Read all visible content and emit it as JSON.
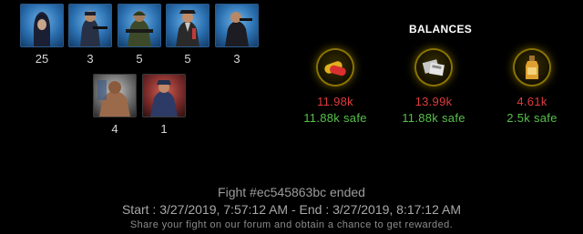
{
  "units": [
    {
      "name": "hooded-agent",
      "count": "25",
      "theme": "blue"
    },
    {
      "name": "mercenary",
      "count": "3",
      "theme": "blue"
    },
    {
      "name": "soldier",
      "count": "5",
      "theme": "blue"
    },
    {
      "name": "gangster",
      "count": "5",
      "theme": "blue"
    },
    {
      "name": "hitman",
      "count": "3",
      "theme": "blue"
    },
    {
      "name": "brawler",
      "count": "4",
      "theme": "grey"
    },
    {
      "name": "thug",
      "count": "1",
      "theme": "red"
    }
  ],
  "balances": {
    "title": "BALANCES",
    "resources": [
      {
        "icon": "pill-capsules-icon",
        "amount": "11.98k",
        "safe": "11.88k safe"
      },
      {
        "icon": "metal-bars-icon",
        "amount": "13.99k",
        "safe": "11.88k safe"
      },
      {
        "icon": "bottle-icon",
        "amount": "4.61k",
        "safe": "2.5k safe"
      }
    ]
  },
  "footer": {
    "fight": "Fight #ec545863bc ended",
    "times": "Start : 3/27/2019, 7:57:12 AM - End : 3/27/2019, 8:17:12 AM",
    "share": "Share your fight on our forum and obtain a chance to get rewarded."
  },
  "colors": {
    "amount": "#e03b3b",
    "safe": "#56c048",
    "accent": "#8a7400"
  }
}
